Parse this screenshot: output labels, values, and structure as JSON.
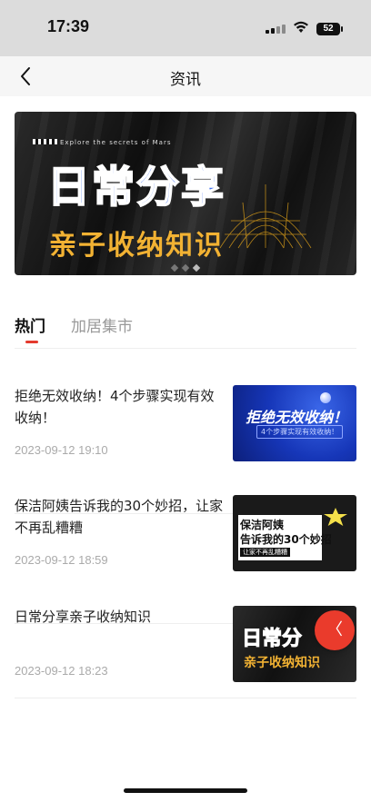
{
  "status_bar": {
    "time": "17:39",
    "battery": "52",
    "icons": [
      "signal-icon",
      "wifi-icon",
      "battery-icon"
    ]
  },
  "nav": {
    "title": "资讯",
    "back_icon": "chevron-left-icon"
  },
  "banner": {
    "tagline": "Explore the secrets of Mars",
    "title": "日常分享",
    "subtitle": "亲子收纳知识",
    "page_count": 3,
    "active_page": 1
  },
  "tabs": [
    {
      "label": "热门",
      "active": true
    },
    {
      "label": "加居集市",
      "active": false
    }
  ],
  "articles": [
    {
      "title": "拒绝无效收纳！4个步骤实现有效收纳！",
      "date": "2023-09-12 19:10",
      "thumb_title": "拒绝无效收纳！",
      "thumb_subtitle": "4个步骤实现有效收纳！"
    },
    {
      "title": "保洁阿姨告诉我的30个妙招，让家不再乱糟糟",
      "date": "2023-09-12 18:59",
      "thumb_line1": "保洁阿姨",
      "thumb_line2": "告诉我的30个妙招",
      "thumb_line3": "让家不再乱糟糟"
    },
    {
      "title": "日常分享亲子收纳知识",
      "date": "2023-09-12 18:23",
      "thumb_title": "日常分",
      "thumb_subtitle": "亲子收纳知识"
    }
  ],
  "float_button": {
    "label": "〈",
    "color": "#ea3b2c"
  },
  "colors": {
    "accent": "#e43a2e",
    "banner_blue": "#3d6df0",
    "banner_gold": "#f2b233"
  }
}
